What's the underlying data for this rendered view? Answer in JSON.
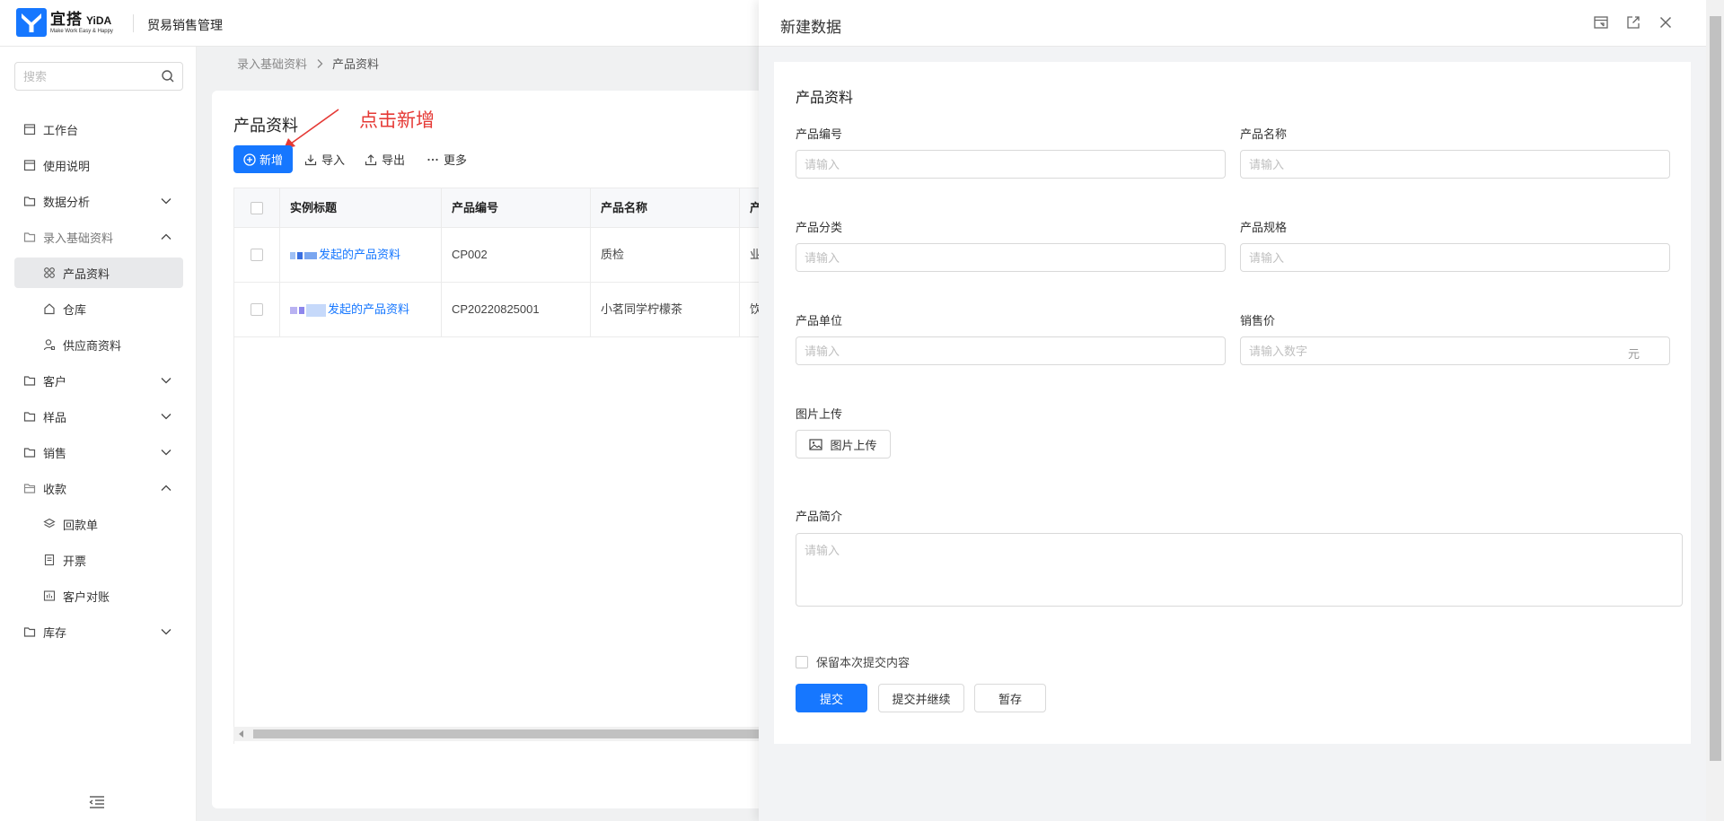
{
  "header": {
    "logo_cn": "宜搭",
    "logo_en": "YiDA",
    "logo_slogan": "Make Work Easy & Happy",
    "app_name": "贸易销售管理"
  },
  "sidebar": {
    "search_placeholder": "搜索",
    "items": [
      {
        "label": "工作台"
      },
      {
        "label": "使用说明"
      },
      {
        "label": "数据分析"
      },
      {
        "label": "录入基础资料"
      },
      {
        "label": "产品资料"
      },
      {
        "label": "仓库"
      },
      {
        "label": "供应商资料"
      },
      {
        "label": "客户"
      },
      {
        "label": "样品"
      },
      {
        "label": "销售"
      },
      {
        "label": "收款"
      },
      {
        "label": "回款单"
      },
      {
        "label": "开票"
      },
      {
        "label": "客户对账"
      },
      {
        "label": "库存"
      }
    ]
  },
  "breadcrumb": {
    "parent": "录入基础资料",
    "current": "产品资料"
  },
  "page": {
    "title": "产品资料",
    "annotation": "点击新增",
    "toolbar": {
      "new": "新增",
      "import": "导入",
      "export": "导出",
      "more": "更多"
    }
  },
  "table": {
    "columns": [
      "实例标题",
      "产品编号",
      "产品名称",
      "产"
    ],
    "rows": [
      {
        "title": "发起的产品资料",
        "code": "CP002",
        "name": "质检",
        "extra": "业"
      },
      {
        "title": "发起的产品资料",
        "code": "CP20220825001",
        "name": "小茗同学柠檬茶",
        "extra": "饮"
      }
    ]
  },
  "drawer": {
    "title": "新建数据",
    "section": "产品资料",
    "fields": {
      "code": {
        "label": "产品编号",
        "placeholder": "请输入"
      },
      "name": {
        "label": "产品名称",
        "placeholder": "请输入"
      },
      "category": {
        "label": "产品分类",
        "placeholder": "请输入"
      },
      "spec": {
        "label": "产品规格",
        "placeholder": "请输入"
      },
      "unit": {
        "label": "产品单位",
        "placeholder": "请输入"
      },
      "price": {
        "label": "销售价",
        "placeholder": "请输入数字",
        "suffix": "元"
      },
      "image": {
        "label": "图片上传",
        "button": "图片上传"
      },
      "desc": {
        "label": "产品简介",
        "placeholder": "请输入"
      }
    },
    "keep_label": "保留本次提交内容",
    "buttons": {
      "submit": "提交",
      "submit_continue": "提交并继续",
      "save_draft": "暂存"
    }
  },
  "colors": {
    "primary": "#1677ff",
    "annotation": "#e53935",
    "logo": "#1677ff"
  }
}
